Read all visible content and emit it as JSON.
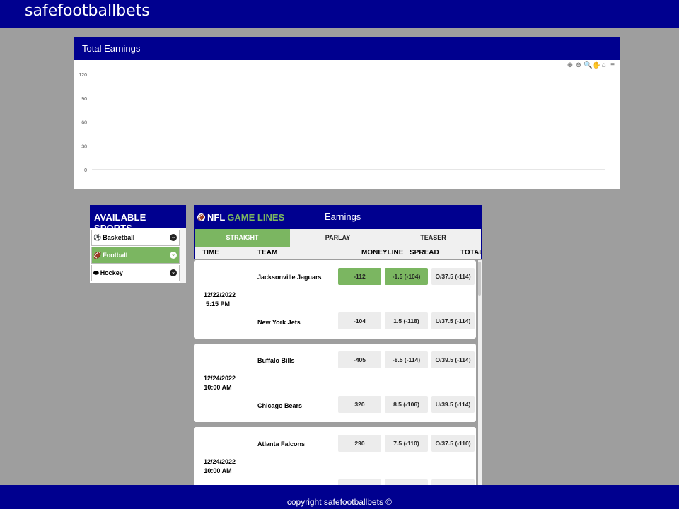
{
  "brand": "safefootballbets",
  "earnings_chart": {
    "title": "Total Earnings",
    "toolbar_icons": [
      "zoom-in-icon",
      "zoom-out-icon",
      "selection-zoom-icon",
      "pan-icon",
      "home-icon",
      "menu-icon"
    ],
    "chart_data": {
      "type": "line",
      "title": "",
      "xlabel": "",
      "ylabel": "",
      "yticks": [
        "120",
        "90",
        "60",
        "30",
        "0"
      ],
      "ylim": [
        0,
        120
      ],
      "series": [],
      "grid": false
    }
  },
  "sports": {
    "title": "AVAILABLE SPORTS",
    "items": [
      {
        "label": "Basketball",
        "icon": "basketball-icon",
        "active": false
      },
      {
        "label": "Football",
        "icon": "football-icon",
        "active": true
      },
      {
        "label": "Hockey",
        "icon": "hockey-puck-icon",
        "active": false
      }
    ]
  },
  "lines": {
    "logo_prefix": "NFL",
    "logo_suffix": "GAME LINES",
    "panel_title": "Earnings",
    "tabs": [
      "STRAIGHT",
      "PARLAY",
      "TEASER"
    ],
    "active_tab": "STRAIGHT",
    "columns": {
      "time": "TIME",
      "team": "TEAM",
      "moneyline": "MONEYLINE",
      "spread": "SPREAD",
      "total": "TOTAL"
    },
    "games": [
      {
        "date": "12/22/2022",
        "time": "5:15 PM",
        "teams": [
          {
            "name": "Jacksonville Jaguars",
            "moneyline": "-112",
            "spread": "-1.5 (-104)",
            "total": "O/37.5 (-114)"
          },
          {
            "name": "New York Jets",
            "moneyline": "-104",
            "spread": "1.5 (-118)",
            "total": "U/37.5 (-114)"
          }
        ]
      },
      {
        "date": "12/24/2022",
        "time": "10:00 AM",
        "teams": [
          {
            "name": "Buffalo Bills",
            "moneyline": "-405",
            "spread": "-8.5 (-114)",
            "total": "O/39.5 (-114)"
          },
          {
            "name": "Chicago Bears",
            "moneyline": "320",
            "spread": "8.5 (-106)",
            "total": "U/39.5 (-114)"
          }
        ]
      },
      {
        "date": "12/24/2022",
        "time": "10:00 AM",
        "teams": [
          {
            "name": "Atlanta Falcons",
            "moneyline": "290",
            "spread": "7.5 (-110)",
            "total": "O/37.5 (-110)"
          }
        ]
      }
    ],
    "selected": [
      {
        "game": 0,
        "team": 0,
        "market": "moneyline"
      },
      {
        "game": 0,
        "team": 0,
        "market": "spread"
      }
    ]
  },
  "footer": {
    "copyright": "copyright safefootballbets ©"
  },
  "colors": {
    "brand_blue": "#00008f",
    "accent_green": "#7bb661",
    "page_bg": "#9e9e9e"
  }
}
